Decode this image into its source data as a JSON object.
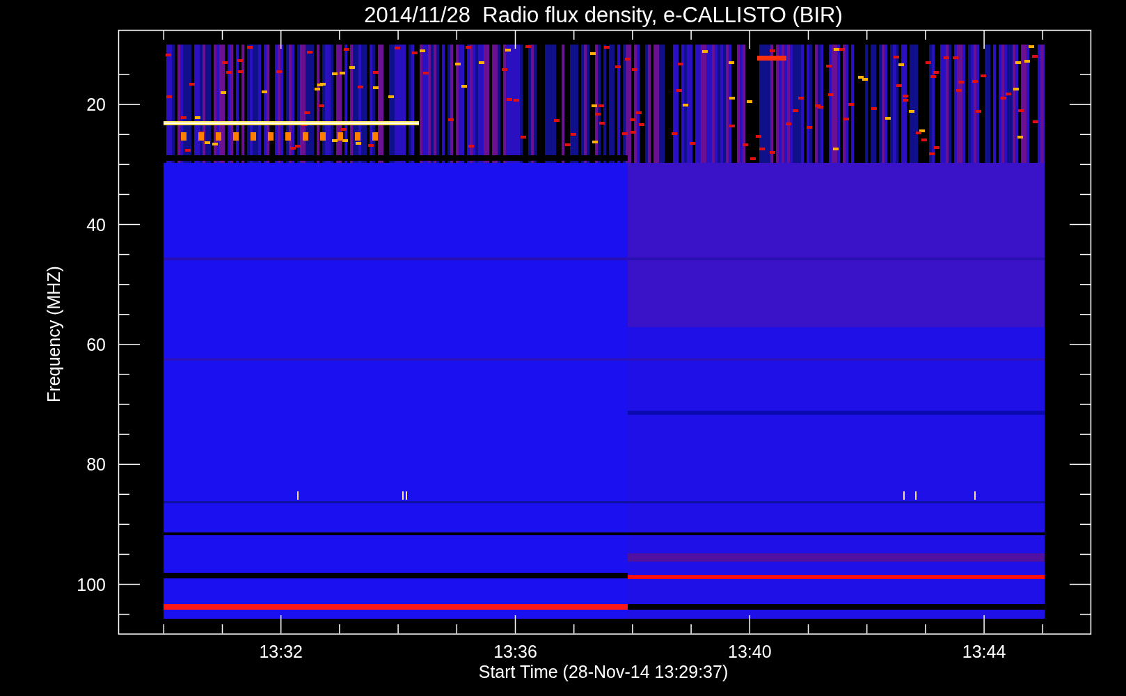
{
  "title": "2014/11/28  Radio flux density, e-CALLISTO (BIR)",
  "y_axis": {
    "label": "Frequency (MHZ)",
    "ticks": [
      "20",
      "40",
      "60",
      "80",
      "100"
    ]
  },
  "x_axis": {
    "label": "Start Time (28-Nov-14 13:29:37)",
    "ticks": [
      "13:32",
      "13:36",
      "13:40",
      "13:44"
    ]
  }
}
